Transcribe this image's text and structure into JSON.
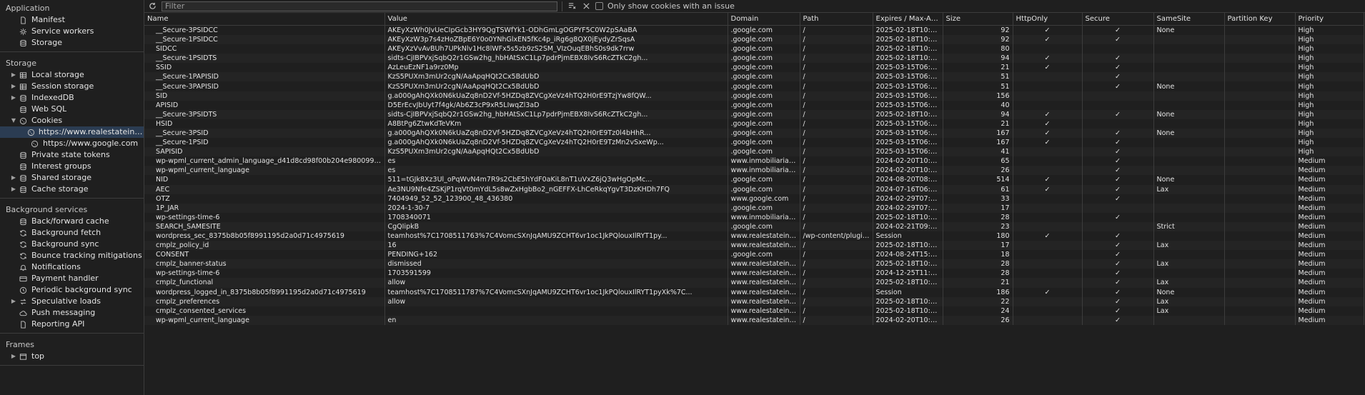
{
  "sidebar": {
    "application": {
      "title": "Application",
      "items": [
        {
          "label": "Manifest",
          "icon": "file-icon"
        },
        {
          "label": "Service workers",
          "icon": "gear-icon"
        },
        {
          "label": "Storage",
          "icon": "database-icon"
        }
      ]
    },
    "storage": {
      "title": "Storage",
      "items": [
        {
          "label": "Local storage",
          "icon": "grid-icon",
          "expandable": true
        },
        {
          "label": "Session storage",
          "icon": "grid-icon",
          "expandable": true
        },
        {
          "label": "IndexedDB",
          "icon": "database-icon",
          "expandable": true
        },
        {
          "label": "Web SQL",
          "icon": "database-icon"
        },
        {
          "label": "Cookies",
          "icon": "cookie-icon",
          "expanded": true
        },
        {
          "label": "https://www.realestateindenia.com",
          "icon": "cookie-icon",
          "child": true,
          "selected": true
        },
        {
          "label": "https://www.google.com",
          "icon": "cookie-icon",
          "child": true
        },
        {
          "label": "Private state tokens",
          "icon": "database-icon"
        },
        {
          "label": "Interest groups",
          "icon": "database-icon"
        },
        {
          "label": "Shared storage",
          "icon": "database-icon",
          "expandable": true
        },
        {
          "label": "Cache storage",
          "icon": "database-icon",
          "expandable": true
        }
      ]
    },
    "background": {
      "title": "Background services",
      "items": [
        {
          "label": "Back/forward cache",
          "icon": "database-icon"
        },
        {
          "label": "Background fetch",
          "icon": "sync-icon"
        },
        {
          "label": "Background sync",
          "icon": "sync-icon"
        },
        {
          "label": "Bounce tracking mitigations",
          "icon": "sync-icon"
        },
        {
          "label": "Notifications",
          "icon": "bell-icon"
        },
        {
          "label": "Payment handler",
          "icon": "card-icon"
        },
        {
          "label": "Periodic background sync",
          "icon": "clock-icon"
        },
        {
          "label": "Speculative loads",
          "icon": "arrows-icon",
          "expandable": true
        },
        {
          "label": "Push messaging",
          "icon": "cloud-icon"
        },
        {
          "label": "Reporting API",
          "icon": "file-icon"
        }
      ]
    },
    "frames": {
      "title": "Frames",
      "items": [
        {
          "label": "top",
          "icon": "frame-icon",
          "expandable": true
        }
      ]
    }
  },
  "toolbar": {
    "filter_placeholder": "Filter",
    "only_issues_label": "Only show cookies with an issue"
  },
  "table": {
    "columns": [
      "Name",
      "Value",
      "Domain",
      "Path",
      "Expires / Max-Age",
      "Size",
      "HttpOnly",
      "Secure",
      "SameSite",
      "Partition Key",
      "Priority"
    ],
    "check": "✓",
    "rows": [
      [
        "__Secure-3PSIDCC",
        "AKEyXzWh0JvUeCIpGcb3HY9QgTSWfYk1-ODhGmLgOGPYF5C0W2pSAaBA",
        ".google.com",
        "/",
        "2025-02-18T10:55:...",
        "92",
        "✓",
        "✓",
        "None",
        "",
        "High"
      ],
      [
        "__Secure-1PSIDCC",
        "AKEyXzW3p7s4zHoZBpE6Y0o0YNhGlxEN5fKc4p_iRg6g8QX0jEydyZrSqsA",
        ".google.com",
        "/",
        "2025-02-18T10:54:...",
        "92",
        "✓",
        "✓",
        "",
        "",
        "High"
      ],
      [
        "SIDCC",
        "AKEyXzVvAvBUh7UPkNlv1Hc8lWFx5s5zb9zS2SM_VIzOuqEBhS0s9dk7rrw",
        ".google.com",
        "/",
        "2025-02-18T10:55:...",
        "80",
        "",
        "",
        "",
        "",
        "High"
      ],
      [
        "__Secure-1PSIDTS",
        "sidts-CjIBPVxjSqbQ2r1GSw2hg_hbHAtSxC1Lp7pdrPjmEBX8IvS6RcZTkC2gh...",
        ".google.com",
        "/",
        "2025-02-18T10:53:...",
        "94",
        "✓",
        "✓",
        "",
        "",
        "High"
      ],
      [
        "SSID",
        "AzLeuEzNF1a9rz0Mp",
        ".google.com",
        "/",
        "2025-03-15T06:34:...",
        "21",
        "✓",
        "✓",
        "",
        "",
        "High"
      ],
      [
        "__Secure-1PAPISID",
        "KzS5PUXm3mUr2cgN/AaApqHQt2Cx5BdUbD",
        ".google.com",
        "/",
        "2025-03-15T06:34:...",
        "51",
        "",
        "✓",
        "",
        "",
        "High"
      ],
      [
        "__Secure-3PAPISID",
        "KzS5PUXm3mUr2cgN/AaApqHQt2Cx5BdUbD",
        ".google.com",
        "/",
        "2025-03-15T06:34:...",
        "51",
        "",
        "✓",
        "None",
        "",
        "High"
      ],
      [
        "SID",
        "g.a000gAhQXk0N6kUaZq8nD2Vf-5HZDq8ZVCgXeVz4hTQ2H0rE9TzjYw8fQW...",
        ".google.com",
        "/",
        "2025-03-15T06:34:...",
        "156",
        "",
        "",
        "",
        "",
        "High"
      ],
      [
        "APISID",
        "D5ErEcvJbUyt7f4gk/Ab6Z3cP9xR5LIwqZl3aD",
        ".google.com",
        "/",
        "2025-03-15T06:34:...",
        "40",
        "",
        "",
        "",
        "",
        "High"
      ],
      [
        "__Secure-3PSIDTS",
        "sidts-CjIBPVxjSqbQ2r1GSw2hg_hbHAtSxC1Lp7pdrPjmEBX8IvS6RcZTkC2gh...",
        ".google.com",
        "/",
        "2025-02-18T10:53:...",
        "94",
        "✓",
        "✓",
        "None",
        "",
        "High"
      ],
      [
        "HSID",
        "A8BtPg6ZtwKdTeVKm",
        ".google.com",
        "/",
        "2025-03-15T06:34:...",
        "21",
        "✓",
        "",
        "",
        "",
        "High"
      ],
      [
        "__Secure-3PSID",
        "g.a000gAhQXk0N6kUaZq8nD2Vf-5HZDq8ZVCgXeVz4hTQ2H0rE9Tz0l4bHhR...",
        ".google.com",
        "/",
        "2025-03-15T06:34:...",
        "167",
        "✓",
        "✓",
        "None",
        "",
        "High"
      ],
      [
        "__Secure-1PSID",
        "g.a000gAhQXk0N6kUaZq8nD2Vf-5HZDq8ZVCgXeVz4hTQ2H0rE9TzMn2vSxeWp...",
        ".google.com",
        "/",
        "2025-03-15T06:34:...",
        "167",
        "✓",
        "✓",
        "",
        "",
        "High"
      ],
      [
        "SAPISID",
        "KzS5PUXm3mUr2cgN/AaApqHQt2Cx5BdUbD",
        ".google.com",
        "/",
        "2025-03-15T06:34:...",
        "41",
        "",
        "✓",
        "",
        "",
        "High"
      ],
      [
        "wp-wpml_current_admin_language_d41d8cd98f00b204e9800998ecf8427e",
        "es",
        "www.inmobiliariade...",
        "/",
        "2024-02-20T10:54:...",
        "65",
        "",
        "✓",
        "",
        "",
        "Medium"
      ],
      [
        "wp-wpml_current_language",
        "es",
        "www.inmobiliariade...",
        "/",
        "2024-02-20T10:54:...",
        "26",
        "",
        "✓",
        "",
        "",
        "Medium"
      ],
      [
        "NID",
        "511=tGJk8Xz3Ul_oPqWvN4m7R9s2CbE5hYdF0aKiL8nT1uVxZ6jQ3wHgOpMc...",
        ".google.com",
        "/",
        "2024-08-20T08:50:...",
        "514",
        "✓",
        "✓",
        "None",
        "",
        "Medium"
      ],
      [
        "AEC",
        "Ae3NU9Nfe4ZSKjP1rqVt0mYdL5s8wZxHgbBo2_nGEFFX-LhCeRkqYgvT3DzKHDh7FQ",
        ".google.com",
        "/",
        "2024-07-16T06:36:...",
        "61",
        "✓",
        "✓",
        "Lax",
        "",
        "Medium"
      ],
      [
        "OTZ",
        "7404949_52_52_123900_48_436380",
        "www.google.com",
        "/",
        "2024-02-29T07:48:...",
        "33",
        "",
        "✓",
        "",
        "",
        "Medium"
      ],
      [
        "1P_JAR",
        "2024-1-30-7",
        ".google.com",
        "/",
        "2024-02-29T07:48:...",
        "17",
        "",
        "",
        "",
        "",
        "Medium"
      ],
      [
        "wp-settings-time-6",
        "1708340071",
        "www.inmobiliariade...",
        "/",
        "2025-02-18T10:54:...",
        "28",
        "",
        "✓",
        "",
        "",
        "Medium"
      ],
      [
        "SEARCH_SAMESITE",
        "CgQIipkB",
        ".google.com",
        "/",
        "2024-02-21T09:02:...",
        "23",
        "",
        "",
        "Strict",
        "",
        "Medium"
      ],
      [
        "wordpress_sec_8375b8b05f8991195d2a0d71c4975619",
        "teamhost%7C1708511763%7C4VomcSXnJqAMU9ZCHT6vr1oc1JkPQlouxIlRYT1py...",
        "www.realestateinde...",
        "/wp-content/plugins",
        "Session",
        "180",
        "✓",
        "✓",
        "",
        "",
        "Medium"
      ],
      [
        "cmplz_policy_id",
        "16",
        "www.realestateinde...",
        "/",
        "2025-02-18T10:55:...",
        "17",
        "",
        "✓",
        "Lax",
        "",
        "Medium"
      ],
      [
        "CONSENT",
        "PENDING+162",
        ".google.com",
        "/",
        "2024-08-24T15:38:...",
        "18",
        "",
        "✓",
        "",
        "",
        "Medium"
      ],
      [
        "cmplz_banner-status",
        "dismissed",
        "www.realestateinde...",
        "/",
        "2025-02-18T10:55:...",
        "28",
        "",
        "✓",
        "Lax",
        "",
        "Medium"
      ],
      [
        "wp-settings-time-6",
        "1703591599",
        "www.realestateinde...",
        "/",
        "2024-12-25T11:53:...",
        "28",
        "",
        "✓",
        "",
        "",
        "Medium"
      ],
      [
        "cmplz_functional",
        "allow",
        "www.realestateinde...",
        "/",
        "2025-02-18T10:55:...",
        "21",
        "",
        "✓",
        "Lax",
        "",
        "Medium"
      ],
      [
        "wordpress_logged_in_8375b8b05f8991195d2a0d71c4975619",
        "teamhost%7C1708511787%7C4VomcSXnJqAMU9ZCHT6vr1oc1JkPQlouxIlRYT1pyXk%7C...",
        "www.realestateinde...",
        "/",
        "Session",
        "186",
        "✓",
        "✓",
        "None",
        "",
        "Medium"
      ],
      [
        "cmplz_preferences",
        "allow",
        "www.realestateinde...",
        "/",
        "2025-02-18T10:55:...",
        "22",
        "",
        "✓",
        "Lax",
        "",
        "Medium"
      ],
      [
        "cmplz_consented_services",
        "",
        "www.realestateinde...",
        "/",
        "2025-02-18T10:55:...",
        "24",
        "",
        "✓",
        "Lax",
        "",
        "Medium"
      ],
      [
        "wp-wpml_current_language",
        "en",
        "www.realestateinde...",
        "/",
        "2024-02-20T10:39:...",
        "26",
        "",
        "✓",
        "",
        "",
        "Medium"
      ]
    ]
  }
}
